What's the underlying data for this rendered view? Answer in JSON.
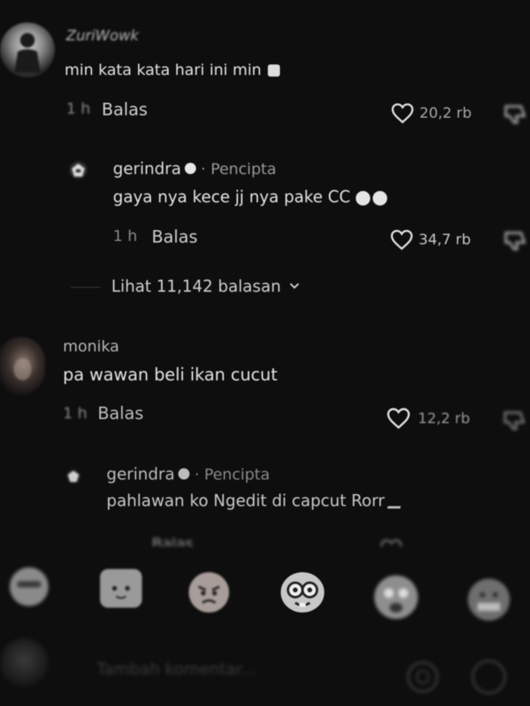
{
  "comments": [
    {
      "username": "ZuriWowk",
      "text": "min kata kata hari ini min",
      "time": "1 h",
      "reply_label": "Balas",
      "likes": "20,2 rb",
      "creator_reply": {
        "username": "gerindra",
        "badge_label": "· Pencipta",
        "text": "gaya nya kece jj nya pake CC",
        "time": "1 h",
        "reply_label": "Balas",
        "likes": "34,7 rb"
      },
      "view_replies": "Lihat 11,142 balasan"
    },
    {
      "username": "monika",
      "text": "pa wawan beli ikan cucut",
      "time": "1 h",
      "reply_label": "Balas",
      "likes": "12,2 rb",
      "creator_reply": {
        "username": "gerindra",
        "badge_label": "· Pencipta",
        "text": "pahlawan ko Ngedit di capcut Rorr",
        "time": "",
        "reply_label": "Balas",
        "likes": ""
      }
    }
  ],
  "emoji_bar": [
    "cool-face-icon",
    "cat-face-icon",
    "angry-face-icon",
    "nerd-face-icon",
    "scared-face-icon",
    "grimace-face-icon"
  ],
  "input": {
    "placeholder": "Tambah komentar..."
  },
  "icons": {
    "heart": "heart-icon",
    "dislike": "thumbs-down-icon",
    "mention": "at-icon",
    "emoji": "emoji-icon"
  }
}
